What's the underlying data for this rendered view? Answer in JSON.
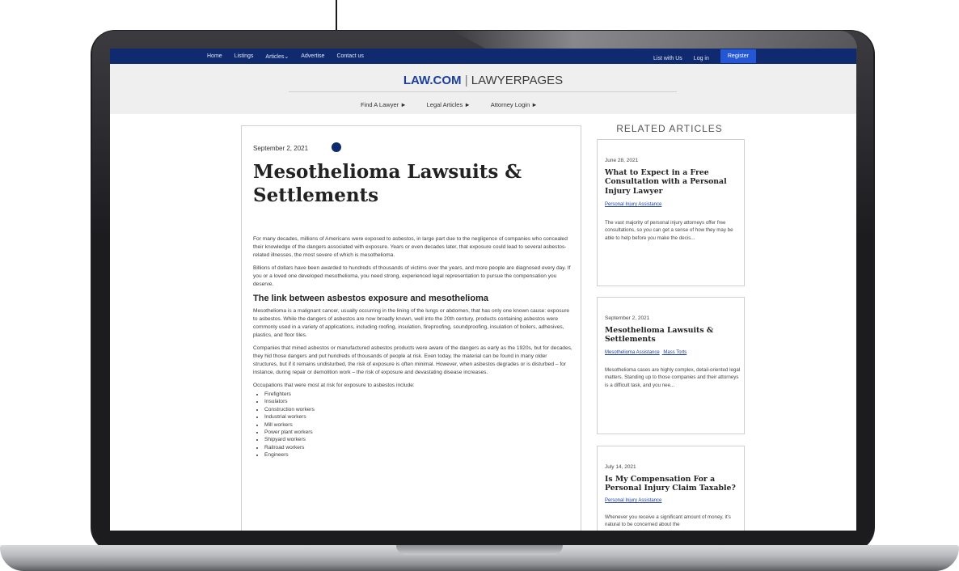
{
  "nav": {
    "left": [
      "Home",
      "Listings",
      "Articles⌄",
      "Advertise",
      "Contact us"
    ],
    "list_with_us": "List with Us",
    "login": "Log in",
    "register": "Register"
  },
  "brand": {
    "law": "LAW.COM",
    "sep": " | ",
    "lawyerpages": "LAWYERPAGES"
  },
  "subnav": [
    "Find A Lawyer ►",
    "Legal Articles ►",
    "Attorney Login ►"
  ],
  "article": {
    "date": "September 2, 2021",
    "title": "Mesothelioma Lawsuits & Settlements",
    "p1": "For many decades, millions of Americans were exposed to asbestos, in large part due to the negligence of companies who concealed their knowledge of the dangers associated with exposure. Years or even decades later, that exposure could lead to several asbestos-related illnesses, the most severe of which is mesothelioma.",
    "p2": "Billions of dollars have been awarded to hundreds of thousands of victims over the years, and more people are diagnosed every day. If you or a loved one developed mesothelioma, you need strong, experienced legal representation to pursue the compensation you deserve.",
    "h2": "The link between asbestos exposure and mesothelioma",
    "p3": "Mesothelioma is a malignant cancer, usually occurring in the lining of the lungs or abdomen, that has only one known cause: exposure to asbestos. While the dangers of asbestos are now broadly known, well into the 20th century, products containing asbestos were commonly used in a variety of applications, including roofing, insulation, fireproofing, soundproofing, insulation of boilers, adhesives, plastics, and floor tiles.",
    "p4": "Companies that mined asbestos or manufactured asbestos products were aware of the dangers as early as the 1920s, but for decades, they hid those dangers and put hundreds of thousands of people at risk. Even today, the material can be found in many older structures, but if it remains undisturbed, the risk of exposure is often minimal. However, when asbestos degrades or is disturbed – for instance, during repair or demolition work – the risk of exposure and devastating disease increases.",
    "p5": "Occupations that were most at risk for exposure to asbestos include:",
    "list": [
      "Firefighters",
      "Insulators",
      "Construction workers",
      "Industrial workers",
      "Mill workers",
      "Power plant workers",
      "Shipyard workers",
      "Railroad workers",
      "Engineers"
    ]
  },
  "related": {
    "heading": "RELATED ARTICLES",
    "cards": [
      {
        "date": "June 28, 2021",
        "title": "What to Expect in a Free Consultation with a Personal Injury Lawyer",
        "tags": [
          "Personal Injury Assistance"
        ],
        "excerpt": "The vast majority of personal injury attorneys offer free consultations, so you can get a sense of how they may be able to help before you make the decis..."
      },
      {
        "date": "September 2, 2021",
        "title": "Mesothelioma Lawsuits & Settlements",
        "tags": [
          "Mesothelioma Assistance",
          "Mass Torts"
        ],
        "excerpt": "Mesothelioma cases are highly complex, detail-oriented legal matters. Standing up to those companies and their attorneys is a difficult task, and you nee..."
      },
      {
        "date": "July 14, 2021",
        "title": "Is My Compensation For a Personal Injury Claim Taxable?",
        "tags": [
          "Personal Injury Assistance"
        ],
        "excerpt": "Whenever you receive a significant amount of money, it's natural to be concerned about the"
      }
    ]
  }
}
